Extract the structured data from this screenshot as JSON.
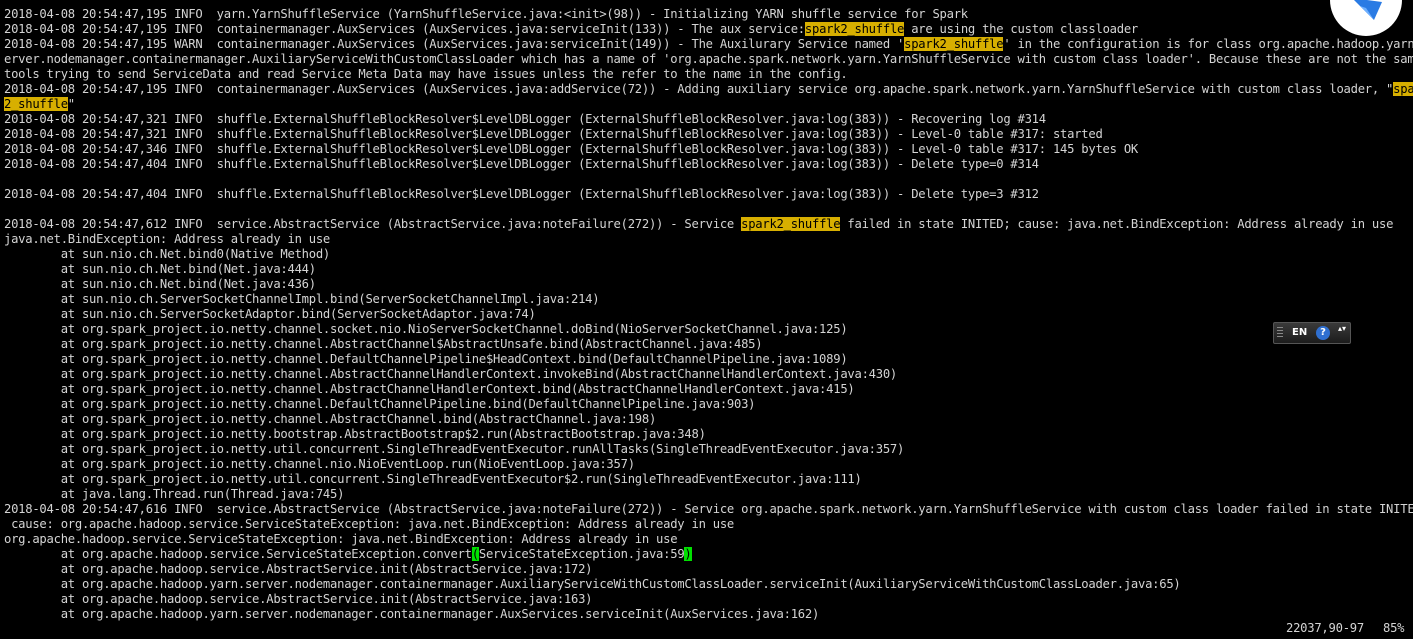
{
  "terminal": {
    "lines": [
      [
        {
          "t": "2018-04-08 20:54:47,195 INFO  yarn.YarnShuffleService (YarnShuffleService.java:<init>(98)) - Initializing YARN shuffle service for Spark"
        }
      ],
      [
        {
          "t": "2018-04-08 20:54:47,195 INFO  containermanager.AuxServices (AuxServices.java:serviceInit(133)) - The aux service:"
        },
        {
          "t": "spark2_shuffle",
          "h": "match"
        },
        {
          "t": " are using the custom classloader"
        }
      ],
      [
        {
          "t": "2018-04-08 20:54:47,195 WARN  containermanager.AuxServices (AuxServices.java:serviceInit(149)) - The Auxilurary Service named '"
        },
        {
          "t": "spark2_shuffle",
          "h": "match"
        },
        {
          "t": "' in the configuration is for class org.apache.hadoop.yarn.s"
        }
      ],
      [
        {
          "t": "erver.nodemanager.containermanager.AuxiliaryServiceWithCustomClassLoader which has a name of 'org.apache.spark.network.yarn.YarnShuffleService with custom class loader'. Because these are not the same"
        }
      ],
      [
        {
          "t": "tools trying to send ServiceData and read Service Meta Data may have issues unless the refer to the name in the config."
        }
      ],
      [
        {
          "t": "2018-04-08 20:54:47,195 INFO  containermanager.AuxServices (AuxServices.java:addService(72)) - Adding auxiliary service org.apache.spark.network.yarn.YarnShuffleService with custom class loader, \""
        },
        {
          "t": "spark",
          "h": "match"
        }
      ],
      [
        {
          "t": "2_shuffle",
          "h": "match"
        },
        {
          "t": "\""
        }
      ],
      [
        {
          "t": "2018-04-08 20:54:47,321 INFO  shuffle.ExternalShuffleBlockResolver$LevelDBLogger (ExternalShuffleBlockResolver.java:log(383)) - Recovering log #314"
        }
      ],
      [
        {
          "t": "2018-04-08 20:54:47,321 INFO  shuffle.ExternalShuffleBlockResolver$LevelDBLogger (ExternalShuffleBlockResolver.java:log(383)) - Level-0 table #317: started"
        }
      ],
      [
        {
          "t": "2018-04-08 20:54:47,346 INFO  shuffle.ExternalShuffleBlockResolver$LevelDBLogger (ExternalShuffleBlockResolver.java:log(383)) - Level-0 table #317: 145 bytes OK"
        }
      ],
      [
        {
          "t": "2018-04-08 20:54:47,404 INFO  shuffle.ExternalShuffleBlockResolver$LevelDBLogger (ExternalShuffleBlockResolver.java:log(383)) - Delete type=0 #314"
        }
      ],
      [
        {
          "t": ""
        }
      ],
      [
        {
          "t": "2018-04-08 20:54:47,404 INFO  shuffle.ExternalShuffleBlockResolver$LevelDBLogger (ExternalShuffleBlockResolver.java:log(383)) - Delete type=3 #312"
        }
      ],
      [
        {
          "t": ""
        }
      ],
      [
        {
          "t": "2018-04-08 20:54:47,612 INFO  service.AbstractService (AbstractService.java:noteFailure(272)) - Service "
        },
        {
          "t": "spark2_shuffle",
          "h": "match"
        },
        {
          "t": " failed in state INITED; cause: java.net.BindException: Address already in use"
        }
      ],
      [
        {
          "t": "java.net.BindException: Address already in use"
        }
      ],
      [
        {
          "t": "        at sun.nio.ch.Net.bind0(Native Method)"
        }
      ],
      [
        {
          "t": "        at sun.nio.ch.Net.bind(Net.java:444)"
        }
      ],
      [
        {
          "t": "        at sun.nio.ch.Net.bind(Net.java:436)"
        }
      ],
      [
        {
          "t": "        at sun.nio.ch.ServerSocketChannelImpl.bind(ServerSocketChannelImpl.java:214)"
        }
      ],
      [
        {
          "t": "        at sun.nio.ch.ServerSocketAdaptor.bind(ServerSocketAdaptor.java:74)"
        }
      ],
      [
        {
          "t": "        at org.spark_project.io.netty.channel.socket.nio.NioServerSocketChannel.doBind(NioServerSocketChannel.java:125)"
        }
      ],
      [
        {
          "t": "        at org.spark_project.io.netty.channel.AbstractChannel$AbstractUnsafe.bind(AbstractChannel.java:485)"
        }
      ],
      [
        {
          "t": "        at org.spark_project.io.netty.channel.DefaultChannelPipeline$HeadContext.bind(DefaultChannelPipeline.java:1089)"
        }
      ],
      [
        {
          "t": "        at org.spark_project.io.netty.channel.AbstractChannelHandlerContext.invokeBind(AbstractChannelHandlerContext.java:430)"
        }
      ],
      [
        {
          "t": "        at org.spark_project.io.netty.channel.AbstractChannelHandlerContext.bind(AbstractChannelHandlerContext.java:415)"
        }
      ],
      [
        {
          "t": "        at org.spark_project.io.netty.channel.DefaultChannelPipeline.bind(DefaultChannelPipeline.java:903)"
        }
      ],
      [
        {
          "t": "        at org.spark_project.io.netty.channel.AbstractChannel.bind(AbstractChannel.java:198)"
        }
      ],
      [
        {
          "t": "        at org.spark_project.io.netty.bootstrap.AbstractBootstrap$2.run(AbstractBootstrap.java:348)"
        }
      ],
      [
        {
          "t": "        at org.spark_project.io.netty.util.concurrent.SingleThreadEventExecutor.runAllTasks(SingleThreadEventExecutor.java:357)"
        }
      ],
      [
        {
          "t": "        at org.spark_project.io.netty.channel.nio.NioEventLoop.run(NioEventLoop.java:357)"
        }
      ],
      [
        {
          "t": "        at org.spark_project.io.netty.util.concurrent.SingleThreadEventExecutor$2.run(SingleThreadEventExecutor.java:111)"
        }
      ],
      [
        {
          "t": "        at java.lang.Thread.run(Thread.java:745)"
        }
      ],
      [
        {
          "t": "2018-04-08 20:54:47,616 INFO  service.AbstractService (AbstractService.java:noteFailure(272)) - Service org.apache.spark.network.yarn.YarnShuffleService with custom class loader failed in state INITED;"
        }
      ],
      [
        {
          "t": " cause: org.apache.hadoop.service.ServiceStateException: java.net.BindException: Address already in use"
        }
      ],
      [
        {
          "t": "org.apache.hadoop.service.ServiceStateException: java.net.BindException: Address already in use"
        }
      ],
      [
        {
          "t": "        at org.apache.hadoop.service.ServiceStateException.convert"
        },
        {
          "t": "(",
          "h": "cursor"
        },
        {
          "t": "ServiceStateException.java:59"
        },
        {
          "t": ")",
          "h": "cursor"
        }
      ],
      [
        {
          "t": "        at org.apache.hadoop.service.AbstractService.init(AbstractService.java:172)"
        }
      ],
      [
        {
          "t": "        at org.apache.hadoop.yarn.server.nodemanager.containermanager.AuxiliaryServiceWithCustomClassLoader.serviceInit(AuxiliaryServiceWithCustomClassLoader.java:65)"
        }
      ],
      [
        {
          "t": "        at org.apache.hadoop.service.AbstractService.init(AbstractService.java:163)"
        }
      ],
      [
        {
          "t": "        at org.apache.hadoop.yarn.server.nodemanager.containermanager.AuxServices.serviceInit(AuxServices.java:162)"
        }
      ]
    ]
  },
  "status_bar": {
    "position": "22037,90-97",
    "percent": "85%"
  },
  "ime_toolbar": {
    "language": "EN",
    "help_glyph": "?",
    "menu_glyph": "▴▾",
    "icon": "help-icon"
  },
  "corner_icon": "app-logo-icon",
  "colors": {
    "background": "#000000",
    "text": "#d4d4d4",
    "search_highlight": "#d7af00",
    "cursor": "#00e000"
  }
}
